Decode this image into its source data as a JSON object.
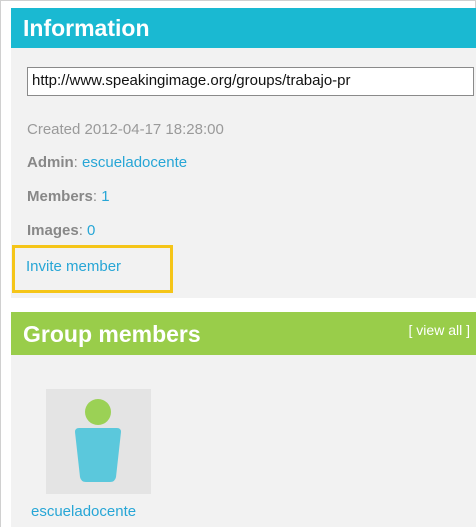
{
  "information": {
    "title": "Information",
    "url_value": "http://www.speakingimage.org/groups/trabajo-pr",
    "created": "Created 2012-04-17 18:28:00",
    "admin_label": "Admin",
    "admin_value": "escueladocente",
    "members_label": "Members",
    "members_value": "1",
    "images_label": "Images",
    "images_value": "0",
    "invite_label": "Invite member"
  },
  "group_members": {
    "title": "Group members",
    "view_all": "[ view all ]",
    "members": [
      {
        "name": "escueladocente",
        "avatar_icon": "user-avatar-icon"
      }
    ]
  },
  "colors": {
    "info_header": "#1ab9d2",
    "group_header": "#99cd4a",
    "link": "#27a6d6",
    "highlight": "#f5c518",
    "avatar_head": "#9bd155",
    "avatar_body": "#5bc8dc"
  }
}
